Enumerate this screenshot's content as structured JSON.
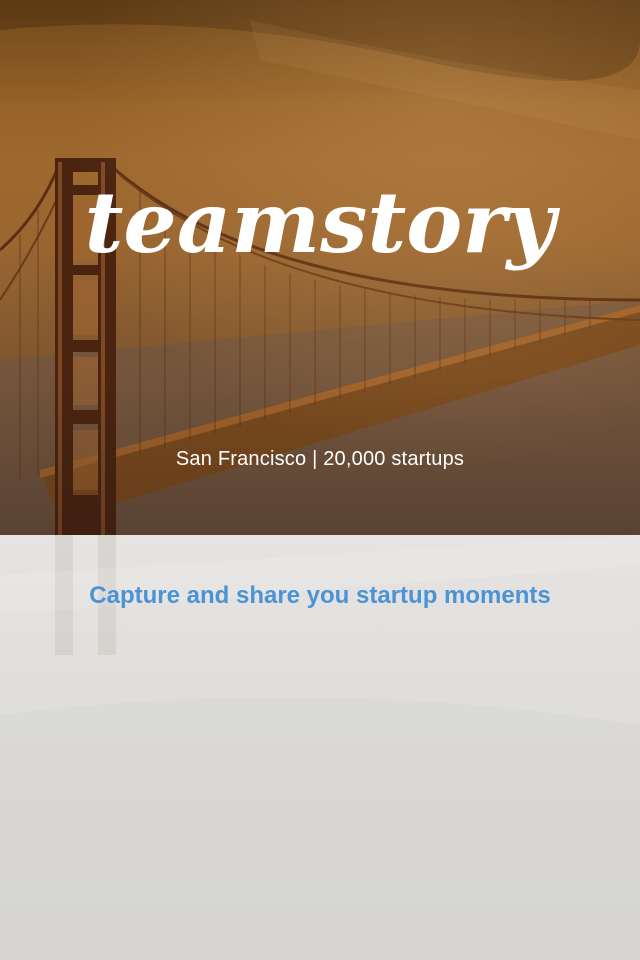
{
  "hero": {
    "logo_text": "teamstory",
    "caption": "San Francisco | 20,000 startups",
    "photo_subject": "golden-gate-bridge"
  },
  "main": {
    "headline": "Capture and share you startup moments"
  },
  "colors": {
    "hero_tint": "#9a6630",
    "headline_blue": "#4a94d6",
    "panel_bg": "#dddbd9",
    "caption_white": "#ffffff"
  }
}
